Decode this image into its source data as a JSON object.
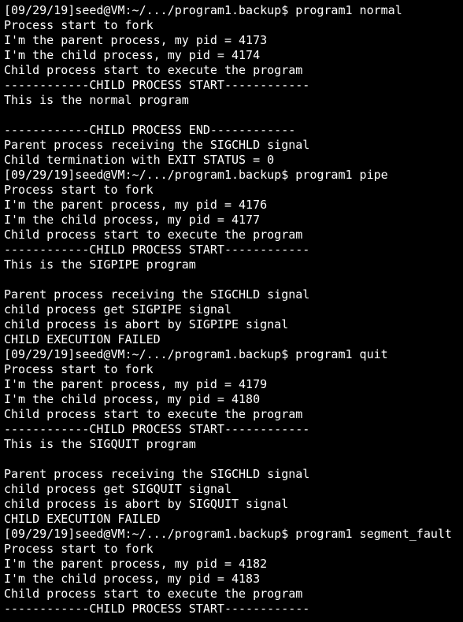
{
  "terminal": {
    "lines": [
      "[09/29/19]seed@VM:~/.../program1.backup$ program1 normal",
      "Process start to fork",
      "I'm the parent process, my pid = 4173",
      "I'm the child process, my pid = 4174",
      "Child process start to execute the program",
      "------------CHILD PROCESS START------------",
      "This is the normal program",
      "",
      "------------CHILD PROCESS END------------",
      "Parent process receiving the SIGCHLD signal",
      "Child termination with EXIT STATUS = 0",
      "[09/29/19]seed@VM:~/.../program1.backup$ program1 pipe",
      "Process start to fork",
      "I'm the parent process, my pid = 4176",
      "I'm the child process, my pid = 4177",
      "Child process start to execute the program",
      "------------CHILD PROCESS START------------",
      "This is the SIGPIPE program",
      "",
      "Parent process receiving the SIGCHLD signal",
      "child process get SIGPIPE signal",
      "child process is abort by SIGPIPE signal",
      "CHILD EXECUTION FAILED",
      "[09/29/19]seed@VM:~/.../program1.backup$ program1 quit",
      "Process start to fork",
      "I'm the parent process, my pid = 4179",
      "I'm the child process, my pid = 4180",
      "Child process start to execute the program",
      "------------CHILD PROCESS START------------",
      "This is the SIGQUIT program",
      "",
      "Parent process receiving the SIGCHLD signal",
      "child process get SIGQUIT signal",
      "child process is abort by SIGQUIT signal",
      "CHILD EXECUTION FAILED",
      "[09/29/19]seed@VM:~/.../program1.backup$ program1 segment_fault",
      "Process start to fork",
      "I'm the parent process, my pid = 4182",
      "I'm the child process, my pid = 4183",
      "Child process start to execute the program",
      "------------CHILD PROCESS START------------"
    ]
  },
  "colors": {
    "background": "#000000",
    "foreground": "#ffffff"
  }
}
